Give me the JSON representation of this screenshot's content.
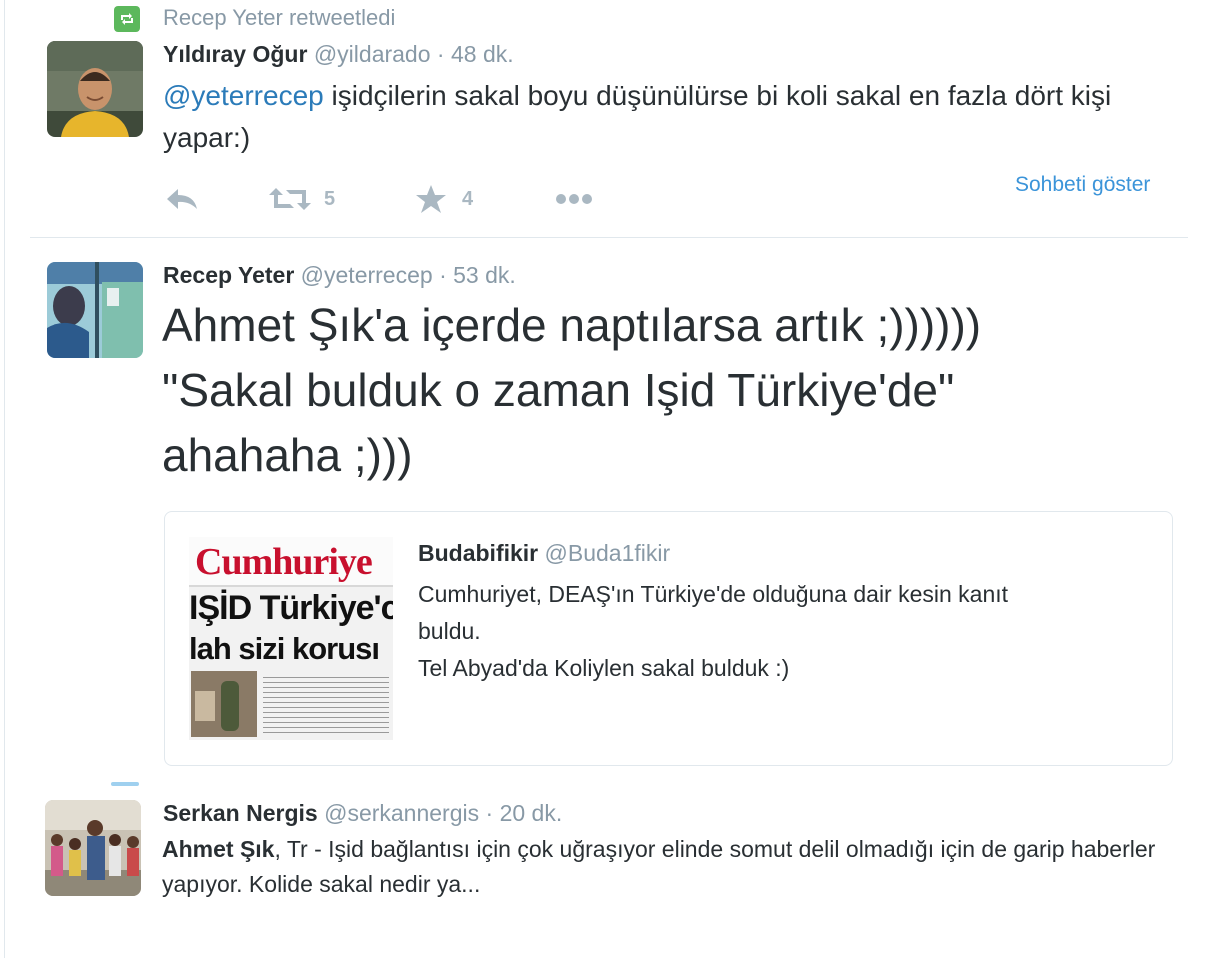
{
  "retweet_context": {
    "icon": "retweet-icon",
    "text": "Recep Yeter retweetledi"
  },
  "tweets": [
    {
      "name": "Yıldıray Oğur",
      "handle": "@yildarado",
      "separator": "·",
      "time": "48 dk.",
      "mention": "@yeterrecep",
      "text": "işidçilerin sakal boyu düşünülürse bi koli sakal en fazla dört kişi yapar:)",
      "retweet_count": "5",
      "favorite_count": "4",
      "conversation_link": "Sohbeti göster"
    },
    {
      "name": "Recep Yeter",
      "handle": "@yeterrecep",
      "separator": "·",
      "time": "53 dk.",
      "lines": [
        "Ahmet Şık'a içerde naptılarsa artık ;))))))",
        "\"Sakal bulduk o zaman Işid Türkiye'de\"",
        "ahahaha ;)))"
      ],
      "quoted": {
        "image_lines": [
          "Cumhuriye",
          "IŞİD Türkiye'c",
          "lah sizi korusı"
        ],
        "name": "Budabifikir",
        "handle": "@Buda1fikir",
        "line1": "Cumhuriyet, DEAŞ'ın Türkiye'de olduğuna dair kesin kanıt",
        "line2": "buldu.",
        "line3": "Tel Abyad'da Koliylen sakal bulduk :)"
      }
    },
    {
      "name": "Serkan Nergis",
      "handle": "@serkannergis",
      "separator": "·",
      "time": "20 dk.",
      "bold_prefix": "Ahmet Şık",
      "text": ", Tr - Işid bağlantısı için çok uğraşıyor elinde somut delil olmadığı için de garip haberler yapıyor. Kolide sakal nedir ya..."
    }
  ],
  "colors": {
    "link": "#2b7bb9",
    "muted": "#8899a6",
    "retweet_green": "#5cb85c",
    "action_gray": "#aab8c2"
  }
}
